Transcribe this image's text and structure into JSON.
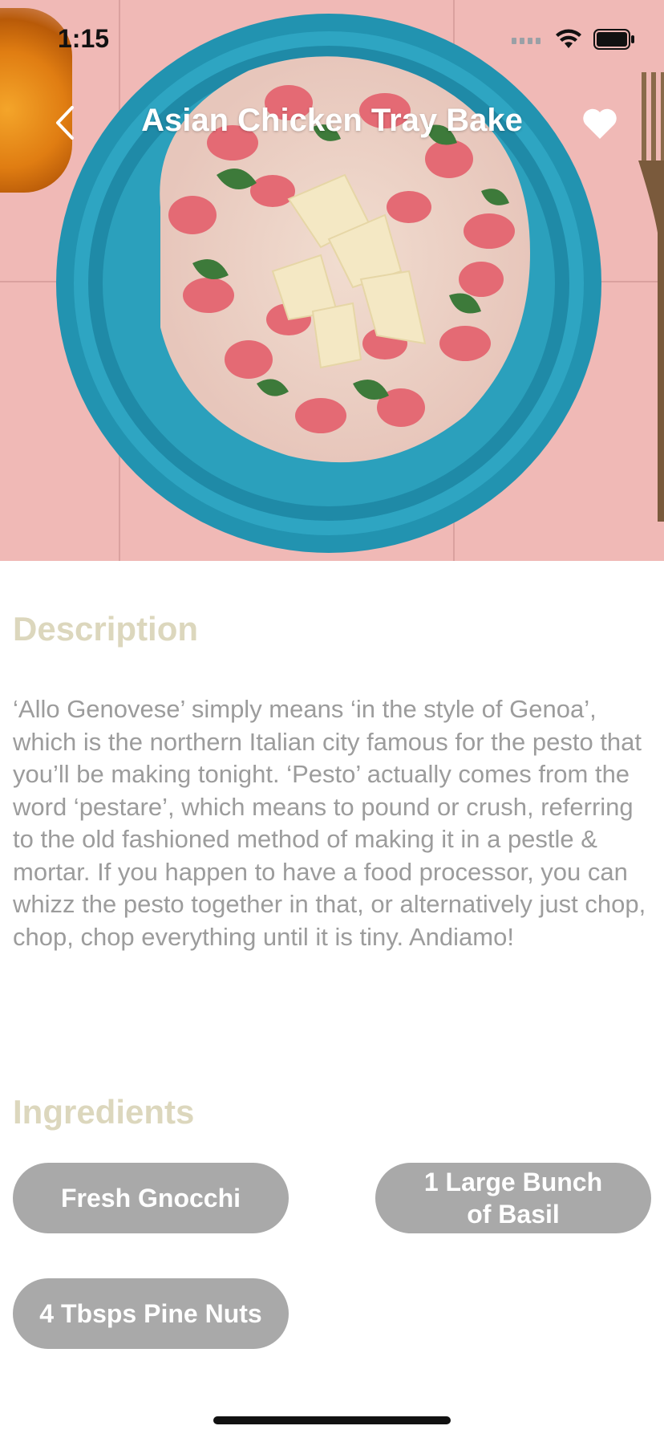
{
  "status_bar": {
    "time": "1:15"
  },
  "nav": {
    "title": "Asian Chicken Tray Bake"
  },
  "icons": {
    "back": "chevron-left-icon",
    "favorite": "heart-icon",
    "wifi": "wifi-icon",
    "battery": "battery-icon",
    "signal": "signal-icon"
  },
  "description": {
    "heading": "Description",
    "body": "‘Allo Genovese’ simply means ‘in the style of Genoa’, which is the northern Italian city famous for the pesto that you’ll be making tonight. ‘Pesto’ actually comes from the word ‘pestare’, which means to pound or crush, referring to the old fashioned method of making it in a pestle & mortar. If you happen to have a food processor, you can whizz the pesto together in that, or alternatively just chop, chop, chop everything until it is tiny. Andiamo!"
  },
  "ingredients": {
    "heading": "Ingredients",
    "items": [
      "Fresh Gnocchi",
      "1 Large Bunch of Basil",
      "4 Tbsps Pine Nuts"
    ]
  },
  "colors": {
    "heading": "#dcd7bd",
    "chip": "#a9a9a9",
    "body_text": "#9c9c9c",
    "plate": "#2b9bb8"
  }
}
